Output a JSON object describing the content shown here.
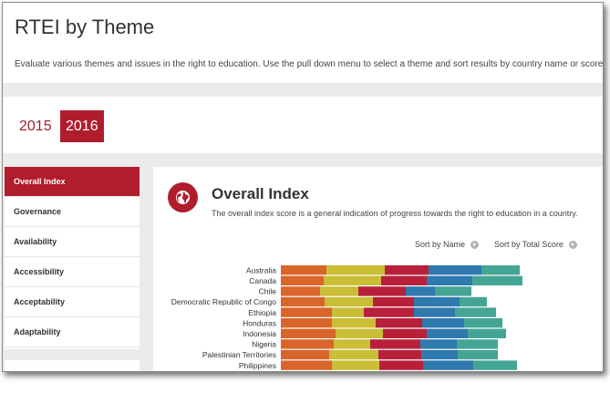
{
  "header": {
    "title": "RTEI by Theme",
    "description": "Evaluate various themes and issues in the right to education. Use the pull down menu to select a theme and sort results by country name or score."
  },
  "years": [
    {
      "label": "2015",
      "selected": false
    },
    {
      "label": "2016",
      "selected": true
    }
  ],
  "sidebar": {
    "items": [
      {
        "label": "Overall Index",
        "active": true
      },
      {
        "label": "Governance"
      },
      {
        "label": "Availability"
      },
      {
        "label": "Accessibility"
      },
      {
        "label": "Acceptability"
      },
      {
        "label": "Adaptability"
      }
    ]
  },
  "panel": {
    "icon": "globe-icon",
    "title": "Overall Index",
    "description": "The overall index score is a general indication of progress towards the right to education in a country.",
    "sort_by_name": "Sort by Name",
    "sort_by_score": "Sort by Total Score"
  },
  "colors": {
    "accent": "#b01d2d",
    "governance": "#d9652a",
    "availability": "#c9be35",
    "accessibility": "#b8203a",
    "acceptability": "#2e79ae",
    "adaptability": "#45a595"
  },
  "chart_data": {
    "type": "bar",
    "stacked": true,
    "orientation": "horizontal",
    "categories": [
      "Australia",
      "Canada",
      "Chile",
      "Democratic Republic of Congo",
      "Ethiopia",
      "Honduras",
      "Indonesia",
      "Nigeria",
      "Palestinian Territories",
      "Philippines"
    ],
    "series": [
      {
        "color": "#d9652a",
        "values": [
          50,
          47,
          43,
          48,
          56,
          56,
          60,
          58,
          53,
          56
        ]
      },
      {
        "color": "#c9be35",
        "values": [
          64,
          63,
          42,
          53,
          35,
          48,
          52,
          40,
          54,
          52
        ]
      },
      {
        "color": "#b8203a",
        "values": [
          48,
          50,
          52,
          45,
          55,
          51,
          48,
          55,
          47,
          48
        ]
      },
      {
        "color": "#2e79ae",
        "values": [
          58,
          50,
          32,
          50,
          45,
          46,
          45,
          40,
          40,
          55
        ]
      },
      {
        "color": "#45a595",
        "values": [
          42,
          55,
          40,
          30,
          45,
          42,
          42,
          45,
          44,
          48
        ]
      }
    ]
  }
}
